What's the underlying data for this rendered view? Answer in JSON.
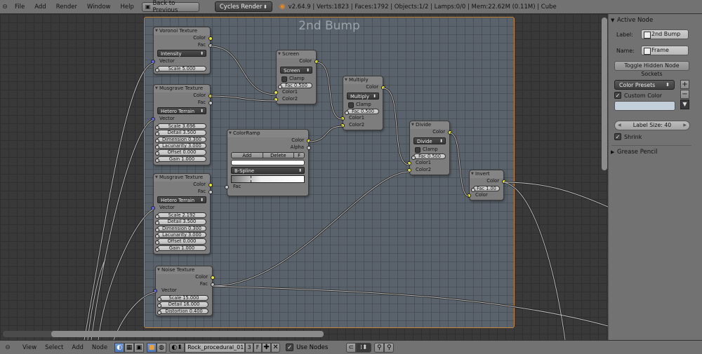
{
  "topbar": {
    "menus": [
      "File",
      "Add",
      "Render",
      "Window",
      "Help"
    ],
    "back_button": "Back to Previous",
    "render_engine": "Cycles Render",
    "stats": "v2.64.9 | Verts:1823 | Faces:1792 | Objects:1/2 | Lamps:0/0 | Mem:22.62M (0.11M) | Cube"
  },
  "frame": {
    "label": "2nd Bump"
  },
  "nodes": {
    "voronoi": {
      "title": "Voronoi Texture",
      "outputs": [
        "Color",
        "Fac"
      ],
      "mode": "Intensity",
      "input": "Vector",
      "fields": [
        "Scale 5.000"
      ]
    },
    "musgrave1": {
      "title": "Musgrave Texture",
      "outputs": [
        "Color",
        "Fac"
      ],
      "mode": "Hetero Terrain",
      "input": "Vector",
      "fields": [
        "Scale 3.696",
        "Detail 3.500",
        "Dimension 0.300",
        "Lacunarity 3.000",
        "Offset 0.000",
        "Gain 1.000"
      ]
    },
    "musgrave2": {
      "title": "Musgrave Texture",
      "outputs": [
        "Color",
        "Fac"
      ],
      "mode": "Hetero Terrain",
      "input": "Vector",
      "fields": [
        "Scale 2.192",
        "Detail 3.500",
        "Dimension 0.300",
        "Lacunarity 3.000",
        "Offset 0.000",
        "Gain 1.000"
      ]
    },
    "noise": {
      "title": "Noise Texture",
      "outputs": [
        "Color",
        "Fac"
      ],
      "input": "Vector",
      "fields": [
        "Scale 15.000",
        "Detail 16.000",
        "Distortion 0.400"
      ]
    },
    "screen": {
      "title": "Screen",
      "output": "Color",
      "mode": "Screen",
      "clamp": "Clamp",
      "fac": "Fac 0.500",
      "inputs": [
        "Color1",
        "Color2"
      ]
    },
    "multiply": {
      "title": "Multiply",
      "output": "Color",
      "mode": "Multiply",
      "clamp": "Clamp",
      "fac": "Fac 0.500",
      "inputs": [
        "Color1",
        "Color2"
      ]
    },
    "divide": {
      "title": "Divide",
      "output": "Color",
      "mode": "Divide",
      "clamp": "Clamp",
      "fac": "Fac 0.500",
      "inputs": [
        "Color1",
        "Color2"
      ]
    },
    "invert": {
      "title": "Invert",
      "output": "Color",
      "fac": "Fac 1.00",
      "input": "Color"
    },
    "colorramp": {
      "title": "ColorRamp",
      "outputs": [
        "Color",
        "Alpha"
      ],
      "add": "Add",
      "delete": "Delete",
      "flip": "F",
      "interpolation": "B-Spline",
      "input": "Fac"
    }
  },
  "panel": {
    "active_node_title": "Active Node",
    "label_label": "Label:",
    "label_value": "2nd Bump",
    "name_label": "Name:",
    "name_value": "Frame",
    "toggle_button": "Toggle Hidden Node Sockets",
    "color_presets": "Color Presets",
    "custom_color": "Custom Color",
    "custom_color_hex": "#c3d0dc",
    "label_size": "Label Size: 40",
    "shrink": "Shrink",
    "grease_pencil": "Grease Pencil"
  },
  "bottombar": {
    "menus": [
      "View",
      "Select",
      "Add",
      "Node"
    ],
    "material_name": "Rock_procedural_01",
    "users": "3",
    "fake": "F",
    "use_nodes": "Use Nodes"
  }
}
